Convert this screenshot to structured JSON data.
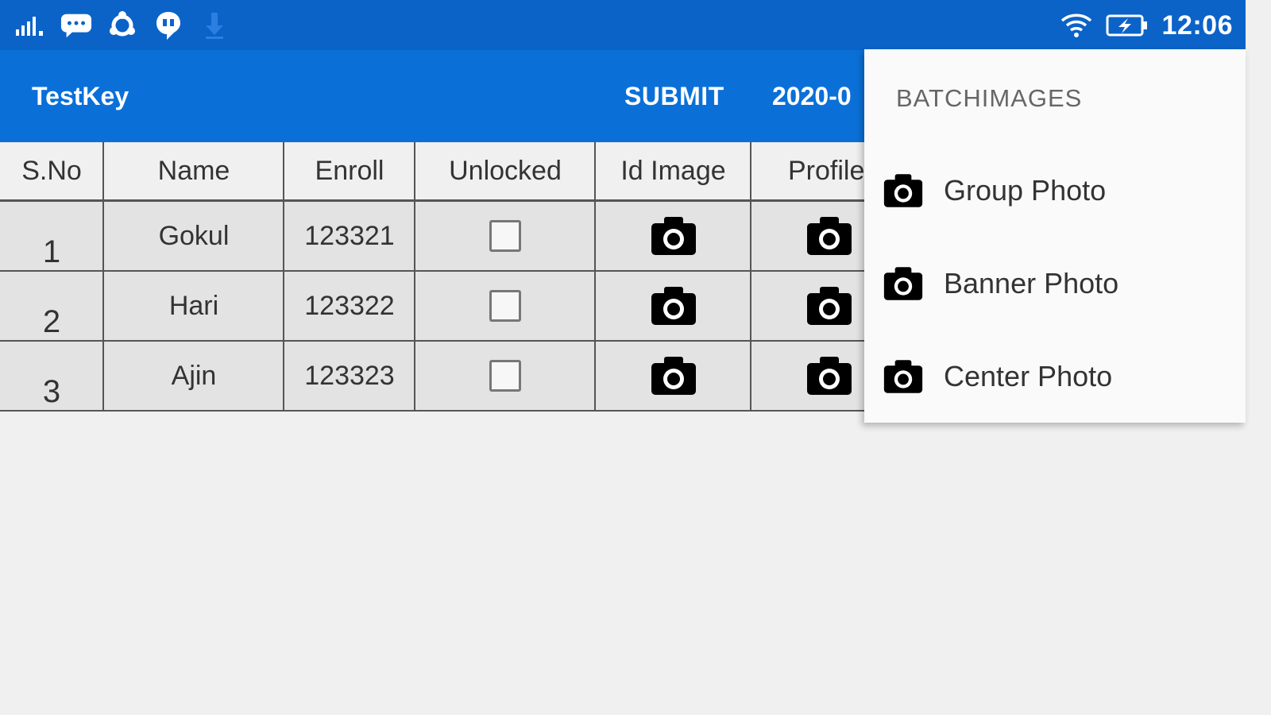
{
  "status_bar": {
    "time": "12:06",
    "left_icons": [
      "signal-icon",
      "message-icon",
      "sync-icon",
      "chat-icon",
      "download-icon"
    ],
    "right_icons": [
      "wifi-icon",
      "battery-charging-icon"
    ]
  },
  "app_bar": {
    "title": "TestKey",
    "submit_label": "SUBMIT",
    "date": "2020-0"
  },
  "table": {
    "headers": [
      "S.No",
      "Name",
      "Enroll",
      "Unlocked",
      "Id Image",
      "Profile"
    ],
    "rows": [
      {
        "sno": "1",
        "name": "Gokul",
        "enroll": "123321",
        "unlocked": false
      },
      {
        "sno": "2",
        "name": "Hari",
        "enroll": "123322",
        "unlocked": false
      },
      {
        "sno": "3",
        "name": "Ajin",
        "enroll": "123323",
        "unlocked": false
      }
    ]
  },
  "menu": {
    "header": "BATCHIMAGES",
    "items": [
      {
        "label": "Group Photo",
        "icon": "camera-icon"
      },
      {
        "label": "Banner Photo",
        "icon": "camera-icon"
      },
      {
        "label": "Center Photo",
        "icon": "camera-icon"
      }
    ]
  },
  "colors": {
    "status_bar": "#0b63c8",
    "app_bar": "#0a70d8",
    "row_background": "#e3e3e3",
    "page_background": "#f0f0f0"
  }
}
